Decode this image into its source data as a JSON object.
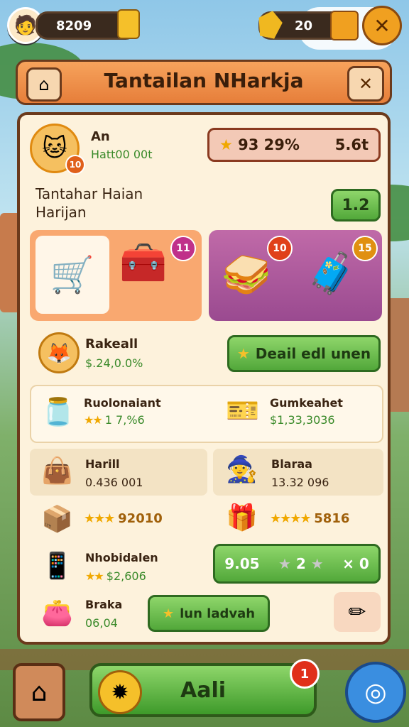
{
  "hud": {
    "coins": "8209",
    "gems": "20",
    "coin_icon": "jar-icon",
    "gem_icon": "gem-icon",
    "chest_icon": "gift-icon"
  },
  "panel": {
    "title": "Tantailan NHarkja",
    "close_symbol": "✕"
  },
  "profile": {
    "name": "An",
    "sub": "Hatt00 00t",
    "level": "10",
    "stat_left": "93 29%",
    "stat_right": "5.6t"
  },
  "section": {
    "title_line1": "Tantahar Haian",
    "title_line2": "Harijan",
    "value_button": "1.2"
  },
  "cards": {
    "card1_badge": "11",
    "card2_badge_a": "10",
    "card2_badge_b": "15"
  },
  "player_row": {
    "name": "Rakeall",
    "value": "$.24,0.0%",
    "action_label": "Deail edl unen"
  },
  "items": [
    {
      "name": "Ruolonaiant",
      "value": "1 7,%6",
      "stars": "★★"
    },
    {
      "name": "Gumkeahet",
      "value": "$1,33,3036"
    },
    {
      "name": "Harill",
      "value": "0.436 001"
    },
    {
      "name": "Blaraa",
      "value": "13.32 096"
    },
    {
      "value": "92010",
      "stars": "★★★"
    },
    {
      "value": "5816",
      "stars": "★★★★"
    },
    {
      "name": "Nhobidalen",
      "value": "$2,606",
      "stars": "★★"
    },
    {
      "name": "Braka",
      "value": "06,04"
    }
  ],
  "exchange": {
    "left": "9.05",
    "middle": "2",
    "right": "× 0"
  },
  "buttons": {
    "lun_label": "lun ladvah",
    "main_label": "Aali",
    "main_badge": "1"
  },
  "colors": {
    "accent_orange": "#e67e3a",
    "panel_bg": "#fdf2dc",
    "border_brown": "#6b3a1c",
    "button_green": "#52a83a"
  }
}
